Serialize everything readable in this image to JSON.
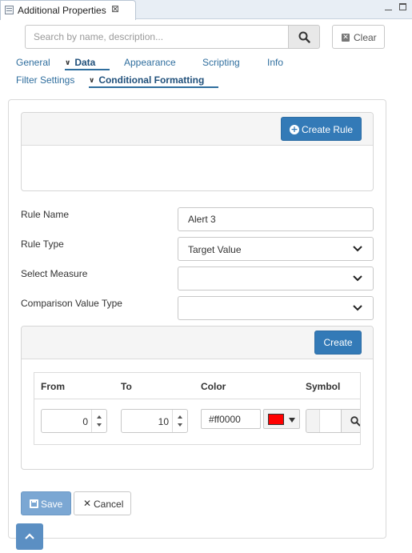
{
  "window": {
    "tab_title": "Additional Properties",
    "close_glyph": "⊠"
  },
  "search": {
    "placeholder": "Search by name, description...",
    "clear_label": "Clear"
  },
  "nav": {
    "tabs": [
      {
        "label": "General"
      },
      {
        "label": "Data",
        "active": true
      },
      {
        "label": "Appearance"
      },
      {
        "label": "Scripting"
      },
      {
        "label": "Info"
      }
    ],
    "subtabs": [
      {
        "label": "Filter Settings"
      },
      {
        "label": "Conditional Formatting",
        "active": true
      }
    ]
  },
  "rules": {
    "create_rule_label": "Create Rule"
  },
  "form": {
    "rule_name_label": "Rule Name",
    "rule_name_value": "Alert 3",
    "rule_type_label": "Rule Type",
    "rule_type_value": "Target Value",
    "select_measure_label": "Select Measure",
    "select_measure_value": "",
    "comparison_value_type_label": "Comparison Value Type",
    "comparison_value_type_value": ""
  },
  "thresholds": {
    "create_label": "Create",
    "columns": {
      "from": "From",
      "to": "To",
      "color": "Color",
      "symbol": "Symbol"
    },
    "rows": [
      {
        "from": "0",
        "to": "10",
        "color": "#ff0000"
      }
    ]
  },
  "footer": {
    "save_label": "Save",
    "cancel_label": "Cancel"
  },
  "colors": {
    "accent": "#337ab7",
    "swatch": "#ff0000",
    "link": "#2f6e9e"
  }
}
